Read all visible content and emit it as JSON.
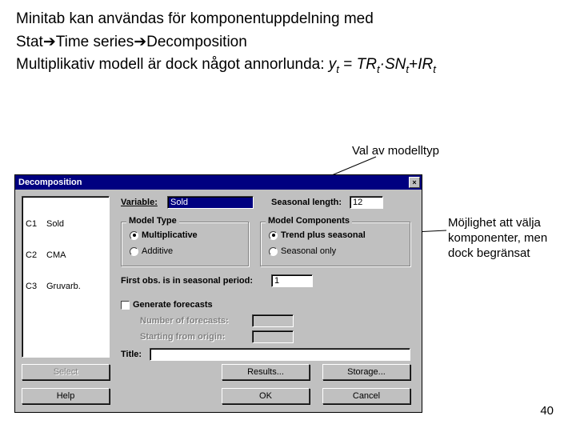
{
  "slide": {
    "line1": "Minitab kan användas för komponentuppdelning med",
    "line2_prefix": "Stat",
    "line2_mid": "Time series",
    "line2_end": "Decomposition",
    "line3_prefix": "Multiplikativ modell är dock något annorlunda: ",
    "formula_lhs": "y",
    "formula_eq": " = ",
    "formula_tr": "TR",
    "formula_dot": "·",
    "formula_sn": "SN",
    "formula_plus": "+",
    "formula_ir": "IR",
    "sub_t": "t"
  },
  "annot": {
    "modeltype": "Val av modelltyp",
    "components": "Möjlighet att välja komponenter, men dock begränsat"
  },
  "dialog": {
    "title": "Decomposition",
    "close": "×",
    "columns": [
      {
        "c": "C1",
        "n": "Sold"
      },
      {
        "c": "C2",
        "n": "CMA"
      },
      {
        "c": "C3",
        "n": "Gruvarb."
      }
    ],
    "variable_label": "Variable:",
    "variable_value": "Sold",
    "season_label": "Seasonal length:",
    "season_value": "12",
    "modeltype_legend": "Model Type",
    "radio_mult": "Multiplicative",
    "radio_add": "Additive",
    "components_legend": "Model Components",
    "radio_trendseason": "Trend plus seasonal",
    "radio_seasononly": "Seasonal only",
    "firstobs_label": "First obs. is in seasonal period:",
    "firstobs_value": "1",
    "gen_forecasts": "Generate forecasts",
    "num_forecasts": "Number of forecasts:",
    "start_origin": "Starting from origin:",
    "title_label": "Title:",
    "btn_select": "Select",
    "btn_help": "Help",
    "btn_results": "Results...",
    "btn_storage": "Storage...",
    "btn_ok": "OK",
    "btn_cancel": "Cancel"
  },
  "pagenum": "40"
}
